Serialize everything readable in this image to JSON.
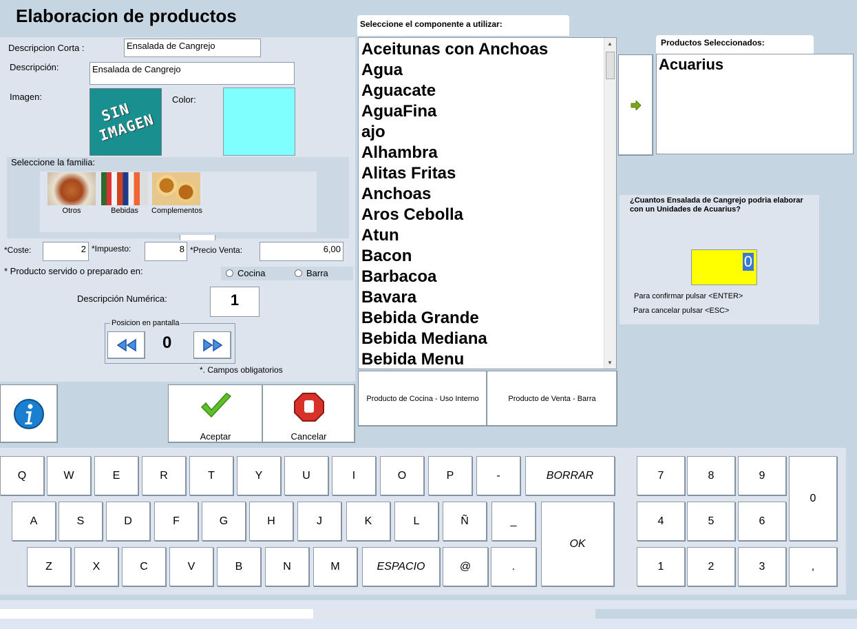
{
  "form": {
    "title": "Elaboracion de productos",
    "short_desc_label": "Descripcion Corta :",
    "short_desc_value": "Ensalada de Cangrejo",
    "desc_label": "Descripción:",
    "desc_value": "Ensalada de Cangrejo",
    "image_label": "Imagen:",
    "image_placeholder_line1": "SIN",
    "image_placeholder_line2": "IMAGEN",
    "color_label": "Color:",
    "color_value": "#80ffff",
    "family_label": "Seleccione la familia:",
    "families": [
      "Otros",
      "Bebidas",
      "Complementos"
    ],
    "coste_label": "*Coste:",
    "coste_value": "2",
    "impuesto_label": "*Impuesto:",
    "impuesto_value": "8",
    "precio_label": "*Precio Venta:",
    "precio_value": "6,00",
    "served_label": "* Producto servido o preparado en:",
    "option_cocina": "Cocina",
    "option_barra": "Barra",
    "num_desc_label": "Descripción Numérica:",
    "num_desc_value": "1",
    "position_label": "Posicion en pantalla",
    "position_value": "0",
    "required_note": "*. Campos obligatorios",
    "accept_label": "Aceptar",
    "cancel_label": "Cancelar"
  },
  "components": {
    "header": "Seleccione el componente a utilizar:",
    "items": [
      "Aceitunas con Anchoas",
      "Agua",
      "Aguacate",
      "AguaFina",
      "ajo",
      "Alhambra",
      "Alitas Fritas",
      "Anchoas",
      "Aros Cebolla",
      "Atun",
      "Bacon",
      "Barbacoa",
      "Bavara",
      "Bebida Grande",
      "Bebida Mediana",
      "Bebida Menu"
    ],
    "btn_cocina": "Producto de Cocina - Uso Interno",
    "btn_venta": "Producto de Venta - Barra"
  },
  "selected": {
    "header": "Productos Seleccionados:",
    "items": [
      "Acuarius"
    ]
  },
  "question": {
    "text": "¿Cuantos Ensalada de Cangrejo podria elaborar con un Unidades de Acuarius?",
    "value": "0",
    "confirm": "Para confirmar pulsar <ENTER>",
    "cancel": "Para cancelar pulsar <ESC>"
  },
  "keyboard": {
    "row1": [
      "Q",
      "W",
      "E",
      "R",
      "T",
      "Y",
      "U",
      "I",
      "O",
      "P",
      "-"
    ],
    "borrar": "BORRAR",
    "row2": [
      "A",
      "S",
      "D",
      "F",
      "G",
      "H",
      "J",
      "K",
      "L",
      "Ñ",
      "_"
    ],
    "ok": "OK",
    "row3": [
      "Z",
      "X",
      "C",
      "V",
      "B",
      "N",
      "M"
    ],
    "espacio": "ESPACIO",
    "row3b": [
      "@",
      "."
    ],
    "numpad_row1": [
      "7",
      "8",
      "9"
    ],
    "numpad_row2": [
      "4",
      "5",
      "6"
    ],
    "numpad_row3": [
      "1",
      "2",
      "3"
    ],
    "zero": "0",
    "comma": ","
  },
  "colors": {
    "background": "#c5d5e2",
    "panel": "#dde4ee",
    "highlight": "#ffff00",
    "accent_blue": "#1a7fd0"
  }
}
